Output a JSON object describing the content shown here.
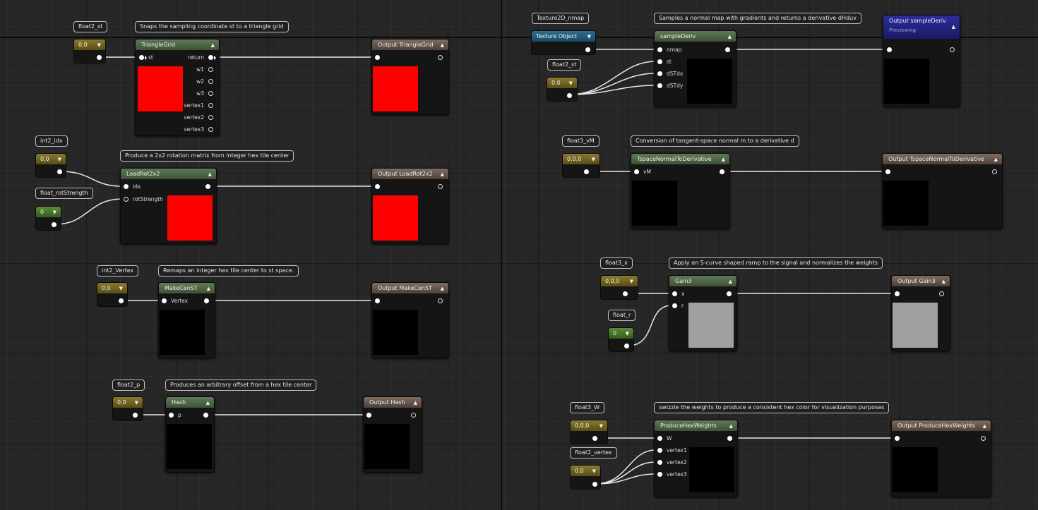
{
  "nodes": {
    "trianglegrid": {
      "title": "TriangleGrid",
      "comment": "Snaps the sampling coordinate st to a triangle grid",
      "inputs": [
        "st"
      ],
      "outputs": [
        "return",
        "w1",
        "w2",
        "w3",
        "vertex1",
        "vertex2",
        "vertex3"
      ],
      "preview_color": "#ff0000"
    },
    "output_trianglegrid": {
      "title": "Output TriangleGrid",
      "preview_color": "#ff0000"
    },
    "loadrot2x2": {
      "title": "LoadRot2x2",
      "comment": "Produce a 2x2 rotation matrix from integer hex tile center",
      "inputs": [
        "idx",
        "rotStrength"
      ],
      "preview_color": "#ff0000"
    },
    "output_loadrot2x2": {
      "title": "Output LoadRot2x2",
      "preview_color": "#ff0000"
    },
    "makecenst": {
      "title": "MakeCenST",
      "comment": "Remaps an integer hex tile center to st space.",
      "inputs": [
        "Vertex"
      ],
      "preview_color": "#000000"
    },
    "output_makecenst": {
      "title": "Output MakeCenST",
      "preview_color": "#000000"
    },
    "hash": {
      "title": "Hash",
      "comment": "Produces an arbitrary offset from a hex tile center",
      "inputs": [
        "p"
      ],
      "preview_color": "#000000"
    },
    "output_hash": {
      "title": "Output Hash",
      "preview_color": "#000000"
    },
    "samplederiv": {
      "title": "sampleDeriv",
      "comment": "Samples a normal map with gradients and returns a derivative dHduv",
      "inputs": [
        "nmap",
        "st",
        "dSTdx",
        "dSTdy"
      ],
      "preview_color": "#000000"
    },
    "output_samplederiv": {
      "title": "Output sampleDeriv",
      "subtitle": "Previewing",
      "preview_color": "#000000"
    },
    "tspace": {
      "title": "TspaceNormalToDerivative",
      "comment": "Conversion of tangent-space normal m to a derivative d",
      "inputs": [
        "vM"
      ],
      "preview_color": "#000000"
    },
    "output_tspace": {
      "title": "Output TspaceNormalToDerivative",
      "preview_color": "#000000"
    },
    "gain3": {
      "title": "Gain3",
      "comment": "Apply an S-curve shaped ramp to the signal and normalizes the weights",
      "inputs": [
        "x",
        "r"
      ],
      "preview_color": "#a0a0a0"
    },
    "output_gain3": {
      "title": "Output Gain3",
      "preview_color": "#a0a0a0"
    },
    "producehex": {
      "title": "ProduceHexWeights",
      "comment": "swizzle the weights to produce a consistent hex color for visualization purposes",
      "inputs": [
        "W",
        "vertex1",
        "vertex2",
        "vertex3"
      ],
      "preview_color": "#000000"
    },
    "output_producehex": {
      "title": "Output ProduceHexWeights",
      "preview_color": "#000000"
    }
  },
  "params": {
    "float2_st": {
      "name": "float2_st",
      "value": "0,0",
      "kind": "vector"
    },
    "int2_idx": {
      "name": "int2_idx",
      "value": "0,0",
      "kind": "vector"
    },
    "float_rotStrength": {
      "name": "float_rotStrength",
      "value": "0",
      "kind": "scalar"
    },
    "int2_Vertex": {
      "name": "int2_Vertex",
      "value": "0,0",
      "kind": "vector"
    },
    "float2_p": {
      "name": "float2_p",
      "value": "0,0",
      "kind": "vector"
    },
    "texture2d_nmap": {
      "name": "Texture2D_nmap",
      "value": "Texture Object",
      "kind": "texture"
    },
    "float2_st_b": {
      "name": "float2_st",
      "value": "0,0",
      "kind": "vector"
    },
    "float3_vM": {
      "name": "float3_vM",
      "value": "0,0,0",
      "kind": "vector"
    },
    "float3_x": {
      "name": "float3_x",
      "value": "0,0,0",
      "kind": "vector"
    },
    "float_r": {
      "name": "float_r",
      "value": "0",
      "kind": "scalar"
    },
    "float3_W": {
      "name": "float3_W",
      "value": "0,0,0",
      "kind": "vector"
    },
    "float2_vertex": {
      "name": "float2_vertex",
      "value": "0,0",
      "kind": "vector"
    }
  },
  "icons": {
    "collapse": "chevron-up-icon",
    "dropdown": "chevron-down-icon"
  },
  "colors": {
    "function_header": "#4e6845",
    "output_header": "#6a5a4e",
    "preview_output_header": "#24247f",
    "vector_param": "#7a6a22",
    "scalar_param": "#4a7a2a",
    "texture_param": "#256080"
  }
}
